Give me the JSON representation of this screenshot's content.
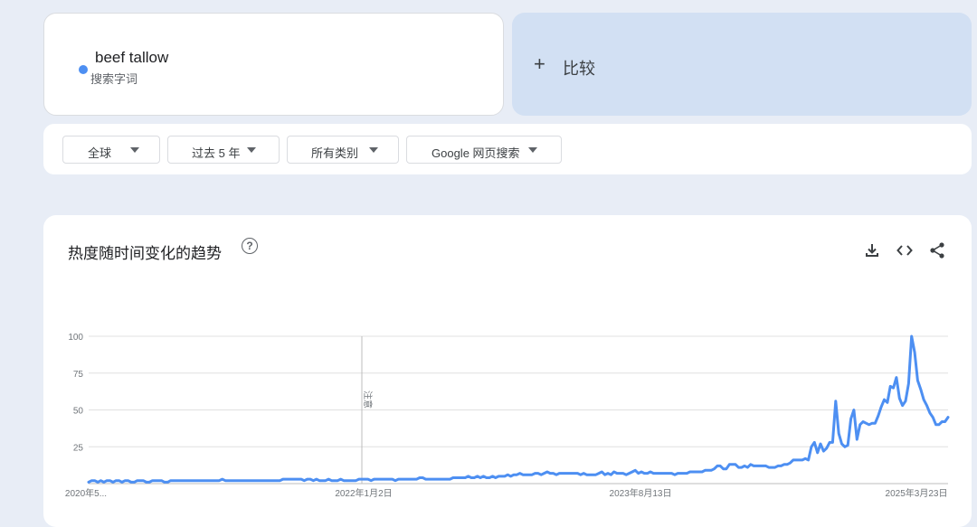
{
  "search_term": {
    "name": "beef tallow",
    "subtitle": "搜索字词",
    "color": "#4d8ff2"
  },
  "compare": {
    "plus": "+",
    "label": "比较"
  },
  "filters": [
    {
      "label": "全球"
    },
    {
      "label": "过去 5 年"
    },
    {
      "label": "所有类别"
    },
    {
      "label": "Google 网页搜索"
    }
  ],
  "chart": {
    "title": "热度随时间变化的趋势",
    "help_icon": "help-circle-icon",
    "tools": [
      "download-icon",
      "embed-code-icon",
      "share-icon"
    ],
    "note_label": "注意"
  },
  "chart_data": {
    "type": "line",
    "ylim": [
      0,
      100
    ],
    "y_ticks": [
      "100",
      "75",
      "50",
      "25"
    ],
    "x_tick_labels": [
      "2020年5...",
      "2022年1月2日",
      "2023年8月13日",
      "2025年3月23日"
    ],
    "series": [
      {
        "values": [
          1,
          2,
          2,
          1,
          2,
          1,
          2,
          2,
          1,
          2,
          2,
          1,
          2,
          2,
          1,
          1,
          2,
          2,
          2,
          1,
          1,
          2,
          2,
          2,
          2,
          1,
          1,
          2,
          2,
          2,
          2,
          2,
          2,
          2,
          2,
          2,
          2,
          2,
          2,
          2,
          2,
          2,
          2,
          2,
          3,
          2,
          2,
          2,
          2,
          2,
          2,
          2,
          2,
          2,
          2,
          2,
          2,
          2,
          2,
          2,
          2,
          2,
          2,
          2,
          3,
          3,
          3,
          3,
          3,
          3,
          3,
          2,
          3,
          3,
          2,
          3,
          2,
          2,
          2,
          3,
          2,
          2,
          2,
          3,
          2,
          2,
          2,
          2,
          2,
          3,
          3,
          3,
          3,
          2,
          3,
          3,
          3,
          3,
          3,
          3,
          3,
          2,
          3,
          3,
          3,
          3,
          3,
          3,
          3,
          4,
          4,
          3,
          3,
          3,
          3,
          3,
          3,
          3,
          3,
          3,
          4,
          4,
          4,
          4,
          4,
          5,
          4,
          4,
          5,
          4,
          5,
          4,
          4,
          5,
          4,
          5,
          5,
          5,
          6,
          5,
          6,
          6,
          7,
          6,
          6,
          6,
          6,
          7,
          7,
          6,
          7,
          8,
          7,
          7,
          6,
          7,
          7,
          7,
          7,
          7,
          7,
          7,
          6,
          7,
          6,
          6,
          6,
          6,
          7,
          8,
          6,
          7,
          6,
          8,
          7,
          7,
          7,
          6,
          7,
          8,
          9,
          7,
          8,
          7,
          7,
          8,
          7,
          7,
          7,
          7,
          7,
          7,
          7,
          6,
          7,
          7,
          7,
          7,
          8,
          8,
          8,
          8,
          8,
          9,
          9,
          9,
          10,
          12,
          12,
          10,
          10,
          13,
          13,
          13,
          11,
          11,
          12,
          11,
          13,
          12,
          12,
          12,
          12,
          12,
          11,
          11,
          11,
          12,
          12,
          13,
          13,
          14,
          16,
          16,
          16,
          16,
          17,
          16,
          25,
          28,
          21,
          27,
          22,
          24,
          28,
          28,
          56,
          34,
          27,
          25,
          26,
          44,
          50,
          30,
          40,
          42,
          41,
          40,
          41,
          41,
          46,
          52,
          57,
          55,
          66,
          65,
          72,
          58,
          53,
          56,
          68,
          100,
          89,
          70,
          64,
          57,
          53,
          48,
          45,
          40,
          40,
          42,
          42,
          45
        ]
      }
    ]
  }
}
